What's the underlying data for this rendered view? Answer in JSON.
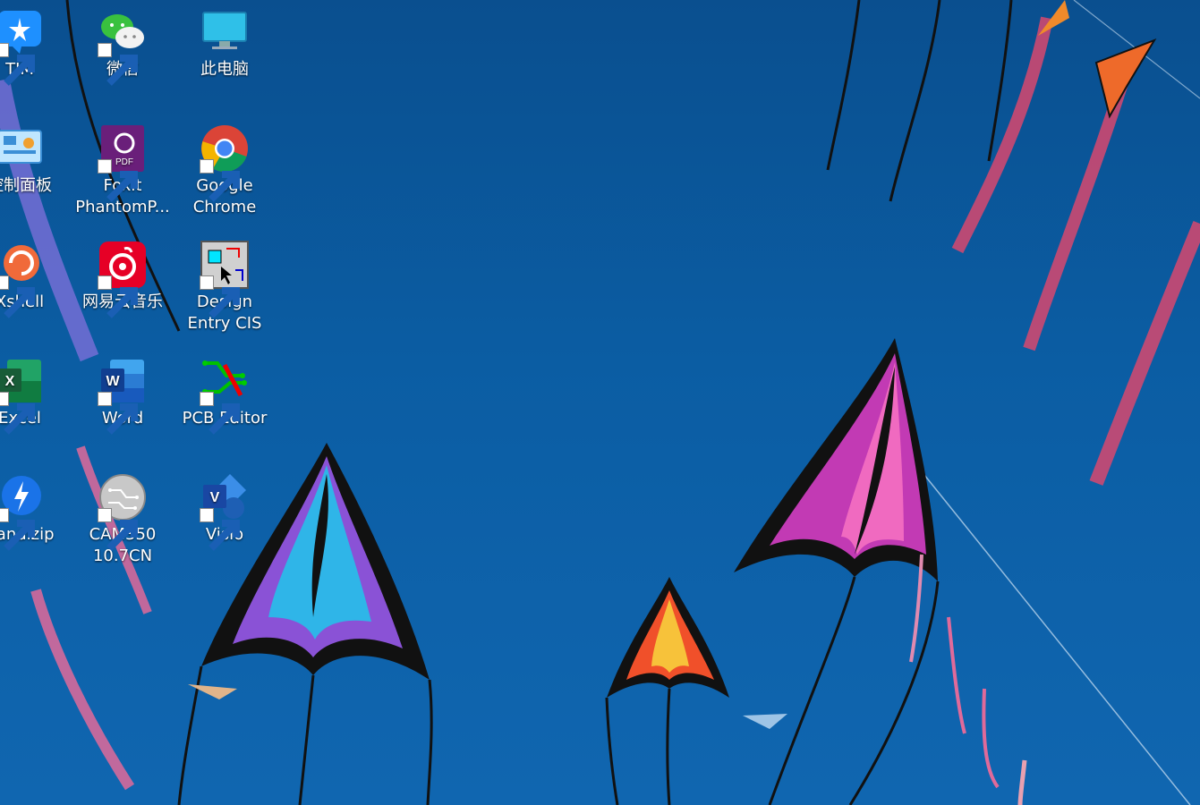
{
  "desktop": {
    "icons": [
      {
        "label": "TIM"
      },
      {
        "label": "微信"
      },
      {
        "label": "此电脑"
      },
      {
        "label": "控制面板"
      },
      {
        "label": "Foxit PhantomP..."
      },
      {
        "label": "Google Chrome"
      },
      {
        "label": "Xshell"
      },
      {
        "label": "网易云音乐"
      },
      {
        "label": "Design Entry CIS"
      },
      {
        "label": "Excel"
      },
      {
        "label": "Word"
      },
      {
        "label": "PCB Editor"
      },
      {
        "label": "Bandizip"
      },
      {
        "label": "CAM350 10.7CN"
      },
      {
        "label": "Visio"
      }
    ],
    "icon_names": [
      "tim-icon",
      "wechat-icon",
      "this-pc-icon",
      "control-panel-icon",
      "foxit-icon",
      "chrome-icon",
      "xshell-icon",
      "netease-music-icon",
      "design-entry-icon",
      "excel-icon",
      "word-icon",
      "pcb-editor-icon",
      "bandizip-icon",
      "cam350-icon",
      "visio-icon"
    ],
    "colors": {
      "sky": "#0b5da3",
      "kite_pink": "#e23aa8",
      "kite_cyan": "#23b6e6",
      "kite_orange": "#f39a2a"
    }
  }
}
